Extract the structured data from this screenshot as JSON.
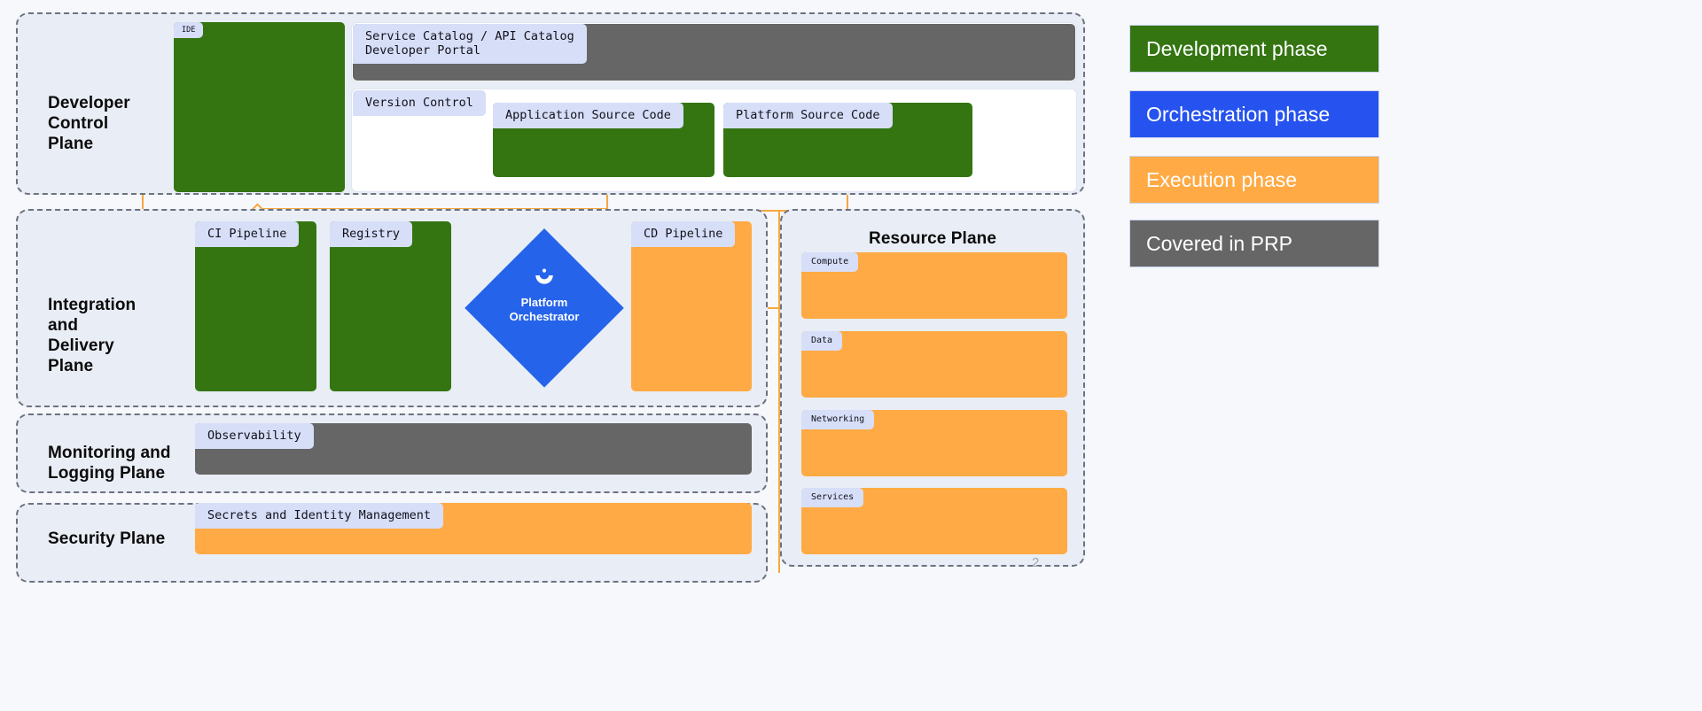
{
  "planes": [
    {
      "id": "developer-control-plane",
      "title": "Developer\nControl\nPlane"
    },
    {
      "id": "integration-and-delivery-plane",
      "title": "Integration\nand\nDelivery\nPlane"
    },
    {
      "id": "monitoring-and-logging-plane",
      "title": "Monitoring and\nLogging Plane"
    },
    {
      "id": "security-plane",
      "title": "Security Plane"
    },
    {
      "id": "resource-plane",
      "title": "Resource Plane"
    }
  ],
  "plane_titles": {
    "developer_control": "Developer Control Plane",
    "integration_delivery": "Integration and Delivery Plane",
    "monitoring_logging": "Monitoring and Logging Plane",
    "security": "Security Plane",
    "resource": "Resource Plane"
  },
  "developer_control_plane": {
    "title_line1": "Developer",
    "title_line2": "Control",
    "title_line3": "Plane",
    "cards": [
      {
        "label": "IDE",
        "color": "green"
      },
      {
        "label": "Service Catalog / API Catalog\nDeveloper Portal",
        "color": "grey"
      },
      {
        "label": "Version Control",
        "color": "white"
      },
      {
        "label": "Application Source Code",
        "color": "green"
      },
      {
        "label": "Platform Source Code",
        "color": "green"
      }
    ]
  },
  "integration_delivery_plane": {
    "title_line1": "Integration",
    "title_line2": "and",
    "title_line3": "Delivery",
    "title_line4": "Plane",
    "cards": [
      {
        "label": "CI Pipeline",
        "color": "green"
      },
      {
        "label": "Registry",
        "color": "green"
      },
      {
        "label": "CD Pipeline",
        "color": "orange"
      }
    ],
    "orchestrator": {
      "line1": "Platform",
      "line2": "Orchestrator",
      "color": "#2563eb",
      "icon": "humanitec-bowl-icon"
    }
  },
  "monitoring_logging_plane": {
    "title_line1": "Monitoring and",
    "title_line2": "Logging Plane",
    "cards": [
      {
        "label": "Observability",
        "color": "grey"
      }
    ]
  },
  "security_plane": {
    "title_line1": "Security Plane",
    "cards": [
      {
        "label": "Secrets and Identity Management",
        "color": "orange"
      }
    ]
  },
  "resource_plane": {
    "title": "Resource Plane",
    "cards": [
      {
        "label": "Compute",
        "color": "orange"
      },
      {
        "label": "Data",
        "color": "orange"
      },
      {
        "label": "Networking",
        "color": "orange"
      },
      {
        "label": "Services",
        "color": "orange"
      }
    ]
  },
  "legend": {
    "items": [
      {
        "label": "Development phase",
        "color": "#347512"
      },
      {
        "label": "Orchestration phase",
        "color": "#2653ef"
      },
      {
        "label": "Execution phase",
        "color": "#ffaa44"
      },
      {
        "label": "Covered in PRP",
        "color": "#666666"
      }
    ]
  },
  "footer": {
    "page_number": "2"
  },
  "colors": {
    "development": "#347512",
    "orchestration": "#2653ef",
    "execution": "#ffaa44",
    "prp": "#666666",
    "tab": "#d7def8",
    "plane_bg": "#e9edf5",
    "plane_border": "#6b7280",
    "connector": "#f5a742"
  }
}
